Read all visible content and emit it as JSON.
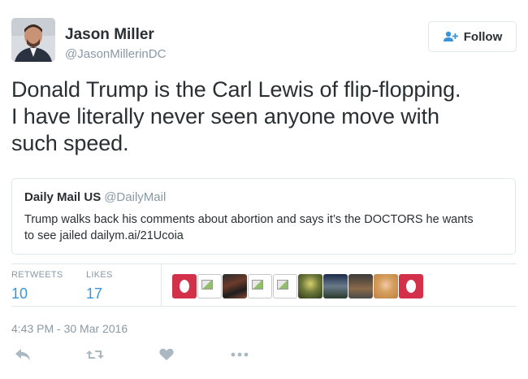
{
  "author": {
    "name": "Jason Miller",
    "handle": "@JasonMillerinDC"
  },
  "follow_button": {
    "label": "Follow",
    "icon": "add-person-icon"
  },
  "tweet": {
    "text_lines": [
      "Donald Trump is the Carl Lewis of flip-flopping.",
      "I have literally never seen anyone move with",
      "such speed."
    ]
  },
  "quoted_tweet": {
    "name": "Daily Mail US",
    "handle": "@DailyMail",
    "text_lines": [
      "Trump walks back his comments about abortion and says it’s the DOCTORS he wants",
      "to see jailed dailym.ai/21Ucoia"
    ]
  },
  "stats": {
    "retweets_label": "RETWEETS",
    "retweets_value": "10",
    "likes_label": "LIKES",
    "likes_value": "17"
  },
  "likers": [
    "red-logo",
    "broken-image",
    "photo",
    "broken-image",
    "broken-image",
    "photo",
    "photo",
    "photo",
    "photo",
    "red-logo"
  ],
  "timestamp": "4:43 PM - 30 Mar 2016",
  "actions": [
    "reply-icon",
    "retweet-icon",
    "like-icon",
    "more-icon"
  ],
  "colors": {
    "text": "#292f33",
    "muted": "#8899a6",
    "link": "#3b94d9",
    "border": "#e1e8ed",
    "icon": "#aab8c2"
  }
}
